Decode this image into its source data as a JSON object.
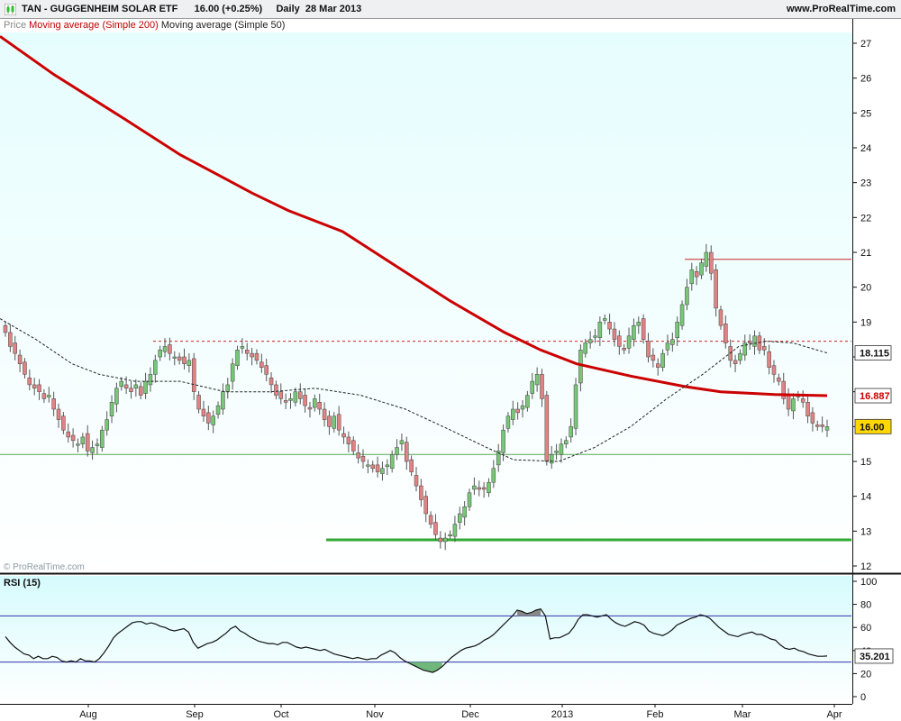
{
  "header": {
    "title": "TAN - GUGGENHEIM SOLAR ETF      16.00 (+0.25%)     Daily  28 Mar 2013",
    "site": "www.ProRealTime.com"
  },
  "legend": {
    "price_label": "Price",
    "ma200_label": "Moving average (Simple 200)",
    "ma50_label": "Moving average (Simple 50)"
  },
  "watermark": "© ProRealTime.com",
  "rsi": {
    "label": "RSI (15)",
    "current_value_label": "35.201",
    "overbought": 70,
    "oversold": 30,
    "axis_ticks": [
      "100",
      "80",
      "60",
      "40",
      "20",
      "0"
    ]
  },
  "price_axis": {
    "ticks": [
      "27",
      "26",
      "25",
      "24",
      "23",
      "22",
      "21",
      "20",
      "19",
      "18",
      "17",
      "16",
      "15",
      "14",
      "13",
      "12"
    ],
    "ma50_tag": "18.115",
    "ma200_tag": "16.887",
    "last_price_tag": "16.00"
  },
  "colors": {
    "background_top": "#e9ffff",
    "background_bottom": "#ffffff",
    "up_candle": "#77c777",
    "down_candle": "#e28383",
    "ma200": "#cc0000",
    "ma50": "#222222",
    "support_line": "#33aa33",
    "last_price_tag_bg": "#ffd800"
  },
  "chart_data": {
    "type": "candlestick",
    "title": "TAN - GUGGENHEIM SOLAR ETF",
    "price_range": [
      11.8,
      27.6
    ],
    "x_ticks": [
      "Aug",
      "Sep",
      "Oct",
      "Nov",
      "Dec",
      "2013",
      "Feb",
      "Mar",
      "Apr"
    ],
    "closes": [
      18.7,
      18.3,
      18.1,
      17.8,
      17.5,
      17.2,
      17.1,
      17.0,
      16.8,
      16.9,
      16.5,
      16.2,
      15.9,
      15.7,
      15.6,
      15.5,
      15.7,
      15.3,
      15.4,
      15.5,
      15.9,
      16.2,
      16.7,
      17.1,
      17.3,
      17.1,
      17.0,
      17.2,
      16.9,
      17.3,
      17.5,
      17.9,
      18.2,
      18.3,
      18.1,
      18.0,
      17.9,
      17.8,
      17.9,
      17.0,
      16.5,
      16.3,
      16.1,
      16.3,
      16.6,
      17.0,
      17.2,
      17.8,
      18.2,
      18.3,
      18.1,
      18.0,
      17.9,
      17.7,
      17.5,
      17.2,
      16.9,
      16.8,
      16.7,
      16.8,
      17.0,
      16.8,
      16.6,
      16.5,
      16.8,
      16.5,
      16.2,
      16.0,
      16.3,
      15.9,
      15.7,
      15.5,
      15.3,
      15.1,
      15.0,
      14.9,
      14.8,
      14.7,
      14.8,
      14.9,
      15.2,
      15.4,
      15.6,
      15.0,
      14.7,
      14.3,
      13.9,
      13.5,
      13.2,
      12.9,
      12.7,
      12.8,
      12.9,
      13.2,
      13.5,
      13.7,
      14.1,
      14.3,
      14.2,
      14.2,
      14.4,
      14.8,
      15.3,
      15.9,
      16.3,
      16.5,
      16.4,
      16.6,
      16.9,
      17.3,
      17.5,
      16.8,
      15.0,
      15.2,
      15.3,
      15.5,
      15.6,
      16.0,
      17.2,
      18.2,
      18.4,
      18.5,
      18.6,
      19.0,
      19.1,
      18.8,
      18.5,
      18.3,
      18.2,
      18.6,
      18.9,
      19.0,
      18.5,
      18.0,
      17.9,
      17.7,
      18.1,
      18.4,
      18.5,
      19.0,
      19.5,
      20.0,
      20.5,
      20.3,
      20.7,
      21.0,
      20.4,
      19.4,
      18.9,
      18.4,
      17.9,
      17.8,
      18.1,
      18.4,
      18.4,
      18.6,
      18.2,
      18.2,
      17.7,
      17.5,
      17.3,
      16.8,
      16.5,
      16.8,
      16.9,
      16.7,
      16.3,
      16.1,
      16.0,
      16.0,
      16.0
    ],
    "ma200_points": [
      [
        0,
        27.2
      ],
      [
        60,
        26.1
      ],
      [
        140,
        24.8
      ],
      [
        200,
        23.8
      ],
      [
        280,
        22.7
      ],
      [
        320,
        22.2
      ],
      [
        380,
        21.6
      ],
      [
        440,
        20.6
      ],
      [
        500,
        19.6
      ],
      [
        560,
        18.7
      ],
      [
        600,
        18.2
      ],
      [
        640,
        17.8
      ],
      [
        700,
        17.45
      ],
      [
        760,
        17.15
      ],
      [
        800,
        17.0
      ],
      [
        860,
        16.92
      ],
      [
        918,
        16.887
      ]
    ],
    "ma50_points": [
      [
        0,
        19.1
      ],
      [
        40,
        18.5
      ],
      [
        80,
        17.8
      ],
      [
        110,
        17.5
      ],
      [
        150,
        17.3
      ],
      [
        200,
        17.3
      ],
      [
        250,
        17.0
      ],
      [
        300,
        17.0
      ],
      [
        350,
        17.1
      ],
      [
        400,
        16.9
      ],
      [
        450,
        16.5
      ],
      [
        500,
        15.9
      ],
      [
        540,
        15.4
      ],
      [
        570,
        15.05
      ],
      [
        620,
        15.0
      ],
      [
        660,
        15.4
      ],
      [
        700,
        16.0
      ],
      [
        740,
        16.8
      ],
      [
        780,
        17.5
      ],
      [
        820,
        18.3
      ],
      [
        850,
        18.45
      ],
      [
        880,
        18.4
      ],
      [
        918,
        18.115
      ]
    ],
    "rsi_values": [
      52,
      47,
      43,
      40,
      37,
      36,
      33,
      35,
      33,
      33,
      35,
      34,
      31,
      30,
      31,
      30,
      33,
      31,
      31,
      30,
      33,
      38,
      44,
      51,
      55,
      58,
      61,
      64,
      65,
      65,
      63,
      64,
      63,
      61,
      60,
      58,
      57,
      58,
      59,
      56,
      47,
      42,
      44,
      46,
      47,
      49,
      52,
      55,
      59,
      61,
      57,
      55,
      52,
      50,
      48,
      47,
      46,
      46,
      45,
      47,
      47,
      45,
      43,
      42,
      43,
      42,
      41,
      40,
      41,
      39,
      37,
      36,
      35,
      34,
      33,
      34,
      33,
      32,
      33,
      33,
      36,
      38,
      40,
      38,
      34,
      31,
      29,
      27,
      25,
      23,
      22,
      21,
      23,
      26,
      30,
      34,
      37,
      40,
      42,
      43,
      44,
      46,
      49,
      51,
      54,
      58,
      62,
      66,
      70,
      75,
      74,
      72,
      73,
      75,
      76,
      70,
      50,
      51,
      51,
      53,
      55,
      60,
      67,
      71,
      71,
      70,
      69,
      70,
      71,
      67,
      64,
      62,
      61,
      63,
      65,
      64,
      62,
      57,
      55,
      54,
      53,
      55,
      58,
      62,
      64,
      66,
      68,
      69,
      71,
      70,
      68,
      64,
      60,
      57,
      54,
      53,
      52,
      54,
      55,
      56,
      54,
      54,
      52,
      50,
      49,
      45,
      42,
      41,
      42,
      40,
      39,
      37,
      36,
      35,
      35,
      35.201
    ]
  }
}
